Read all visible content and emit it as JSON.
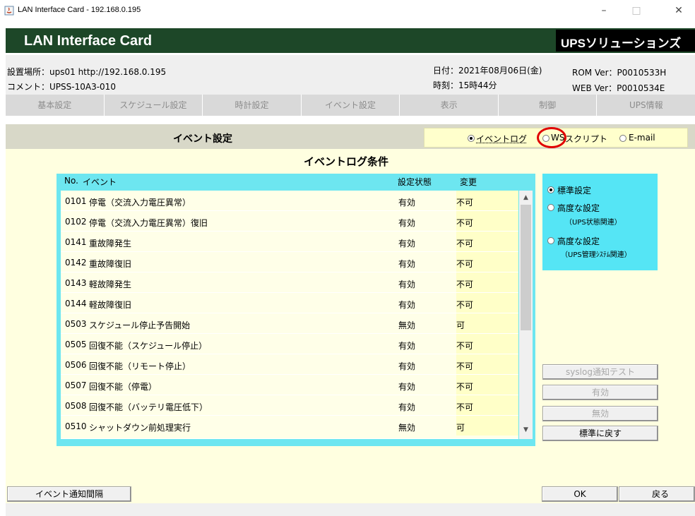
{
  "window": {
    "title": "LAN Interface Card - 192.168.0.195",
    "controls": [
      "–",
      "□",
      "✕"
    ]
  },
  "banner": {
    "title": "LAN Interface Card",
    "brand": "UPSソリューションズ"
  },
  "info": {
    "location_label": "設置場所：",
    "location_value": "ups01 http://192.168.0.195",
    "comment_label": "コメント：",
    "comment_value": "UPSS-10A3-010",
    "date_label": "日付：",
    "date_value": "2021年08月06日(金)",
    "time_label": "時刻：",
    "time_value": "15時44分",
    "rom_label": "ROM Ver：",
    "rom_value": "P0010533H",
    "web_label": "WEB Ver：",
    "web_value": "P0010534E"
  },
  "tabs": [
    "基本設定",
    "スケジュール設定",
    "時計設定",
    "イベント設定",
    "表示",
    "制御",
    "UPS情報"
  ],
  "section": {
    "title": "イベント設定",
    "modes": [
      {
        "label": "イベントログ",
        "selected": true
      },
      {
        "label": "WS",
        "selected": false
      },
      {
        "label": "スクリプト",
        "selected": false
      },
      {
        "label": "E-mail",
        "selected": false
      }
    ]
  },
  "condition_title": "イベントログ条件",
  "table": {
    "headers": {
      "no": "No.",
      "event": "イベント",
      "state": "設定状態",
      "change": "変更"
    },
    "rows": [
      {
        "no": "0101",
        "event": "停電（交流入力電圧異常）",
        "state": "有効",
        "change": "不可"
      },
      {
        "no": "0102",
        "event": "停電（交流入力電圧異常）復旧",
        "state": "有効",
        "change": "不可"
      },
      {
        "no": "0141",
        "event": "重故障発生",
        "state": "有効",
        "change": "不可"
      },
      {
        "no": "0142",
        "event": "重故障復旧",
        "state": "有効",
        "change": "不可"
      },
      {
        "no": "0143",
        "event": "軽故障発生",
        "state": "有効",
        "change": "不可"
      },
      {
        "no": "0144",
        "event": "軽故障復旧",
        "state": "有効",
        "change": "不可"
      },
      {
        "no": "0503",
        "event": "スケジュール停止予告開始",
        "state": "無効",
        "change": "可"
      },
      {
        "no": "0505",
        "event": "回復不能（スケジュール停止）",
        "state": "有効",
        "change": "不可"
      },
      {
        "no": "0506",
        "event": "回復不能（リモート停止）",
        "state": "有効",
        "change": "不可"
      },
      {
        "no": "0507",
        "event": "回復不能（停電）",
        "state": "有効",
        "change": "不可"
      },
      {
        "no": "0508",
        "event": "回復不能（バッテリ電圧低下）",
        "state": "有効",
        "change": "不可"
      },
      {
        "no": "0510",
        "event": "シャットダウン前処理実行",
        "state": "無効",
        "change": "可"
      }
    ]
  },
  "options": {
    "standard": "標準設定",
    "advanced1": "高度な設定",
    "advanced1_sub": "（UPS状態関連）",
    "advanced2": "高度な設定",
    "advanced2_sub": "（UPS管理ｼｽﾃﾑ関連）"
  },
  "buttons": {
    "syslog_test": "syslog通知テスト",
    "enable": "有効",
    "disable": "無効",
    "restore": "標準に戻す",
    "event_interval": "イベント通知間隔",
    "ok": "OK",
    "back": "戻る"
  },
  "colors": {
    "banner_green": "#1d4728",
    "table_frame": "#6de6f0",
    "option_panel": "#55e5f5",
    "body_bg": "#ffffe0",
    "highlight_circle": "#e00000"
  },
  "icons": [
    "java-app-icon",
    "minimize-icon",
    "maximize-icon",
    "close-icon",
    "scroll-up-icon",
    "scroll-down-icon"
  ]
}
